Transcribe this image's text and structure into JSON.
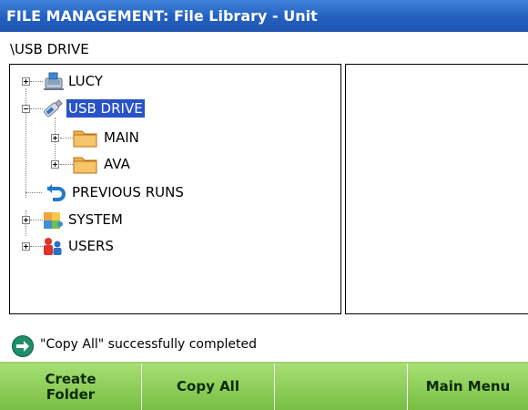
{
  "window": {
    "title": "FILE MANAGEMENT: File Library - Unit"
  },
  "path": "\\USB DRIVE",
  "tree": [
    {
      "label": "LUCY",
      "icon": "computer-icon",
      "expander": "plus"
    },
    {
      "label": "USB DRIVE",
      "icon": "usb-drive-icon",
      "expander": "minus",
      "selected": true
    },
    {
      "label": "MAIN",
      "icon": "folder-icon",
      "expander": "plus"
    },
    {
      "label": "AVA",
      "icon": "folder-icon",
      "expander": "plus"
    },
    {
      "label": "PREVIOUS RUNS",
      "icon": "previous-runs-icon",
      "expander": "none"
    },
    {
      "label": "SYSTEM",
      "icon": "system-icon",
      "expander": "plus"
    },
    {
      "label": "USERS",
      "icon": "users-icon",
      "expander": "plus"
    }
  ],
  "status": {
    "icon": "arrow-right-circle-icon",
    "text": "\"Copy All\" successfully completed"
  },
  "buttons": {
    "create_folder": "Create Folder",
    "copy_all": "Copy All",
    "blank": "",
    "main_menu": "Main Menu"
  },
  "colors": {
    "title_bar": "#2460bf",
    "selection": "#2852c8",
    "button_bar": "#8fcb5c",
    "status_icon": "#1f8f6a"
  }
}
